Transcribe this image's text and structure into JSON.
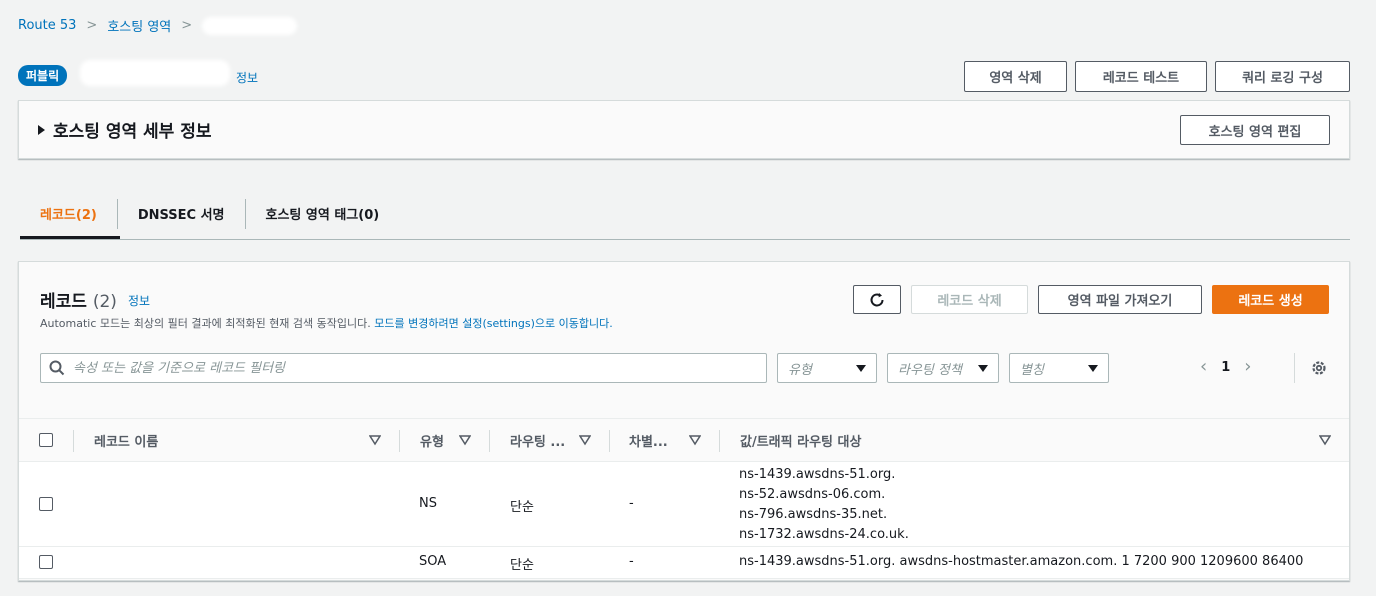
{
  "breadcrumb": {
    "items": [
      "Route 53",
      "호스팅 영역"
    ]
  },
  "header": {
    "badge": "퍼블릭",
    "info_link": "정보"
  },
  "actions": {
    "delete_zone": "영역 삭제",
    "test_record": "레코드 테스트",
    "query_logging": "쿼리 로깅 구성"
  },
  "details": {
    "title": "호스팅 영역 세부 정보",
    "edit_button": "호스팅 영역 편집"
  },
  "tabs": [
    {
      "label": "레코드(2)",
      "active": true
    },
    {
      "label": "DNSSEC 서명",
      "active": false
    },
    {
      "label": "호스팅 영역 태그(0)",
      "active": false
    }
  ],
  "records": {
    "title": "레코드",
    "count": "(2)",
    "info_link": "정보",
    "desc_prefix": "Automatic 모드는 최상의 필터 결과에 최적화된 현재 검색 동작입니다.",
    "desc_link": "모드를 변경하려면 설정(settings)으로 이동합니다.",
    "delete_button": "레코드 삭제",
    "import_button": "영역 파일 가져오기",
    "create_button": "레코드 생성",
    "search_placeholder": "속성 또는 값을 기준으로 레코드 필터링",
    "filter_type": "유형",
    "filter_routing": "라우팅 정책",
    "filter_alias": "별칭",
    "page": "1"
  },
  "table": {
    "columns": [
      "레코드 이름",
      "유형",
      "라우팅 ...",
      "차별...",
      "값/트래픽 라우팅 대상"
    ],
    "rows": [
      {
        "name": "",
        "type": "NS",
        "routing": "단순",
        "diff": "-",
        "values": [
          "ns-1439.awsdns-51.org.",
          "ns-52.awsdns-06.com.",
          "ns-796.awsdns-35.net.",
          "ns-1732.awsdns-24.co.uk."
        ]
      },
      {
        "name": "",
        "type": "SOA",
        "routing": "단순",
        "diff": "-",
        "values": [
          "ns-1439.awsdns-51.org. awsdns-hostmaster.amazon.com. 1 7200 900 1209600 86400"
        ]
      }
    ]
  },
  "colors": {
    "accent": "#ec7211",
    "link": "#0073bb",
    "badge": "#0073bb"
  }
}
